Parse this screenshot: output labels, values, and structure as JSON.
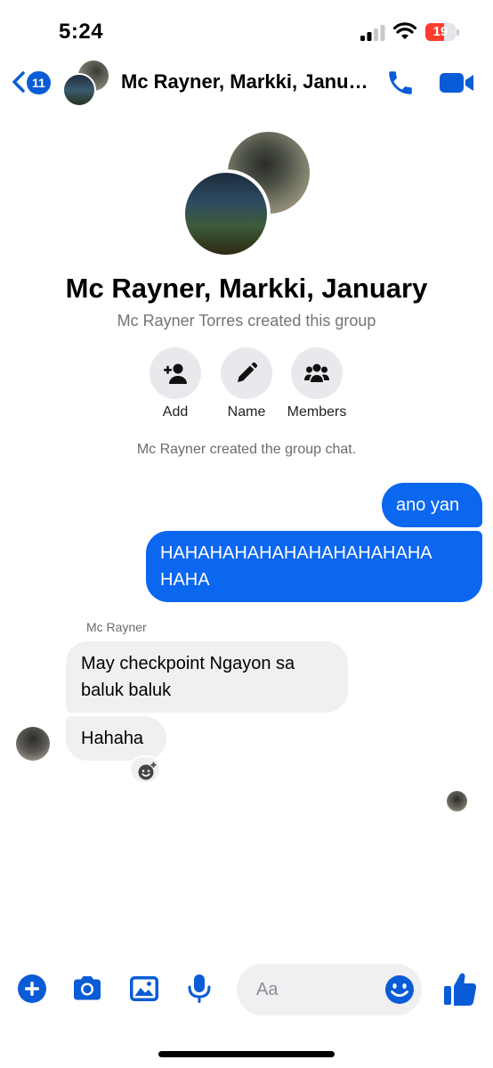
{
  "status_bar": {
    "time": "5:24",
    "battery": "19",
    "battery_level": 0.19,
    "icons": [
      "cellular-signal-icon",
      "wifi-icon",
      "battery-icon"
    ]
  },
  "header": {
    "back_count": "11",
    "title": "Mc Rayner, Markki, January",
    "icons": [
      "chevron-left-icon",
      "phone-icon",
      "video-camera-icon"
    ]
  },
  "group": {
    "name": "Mc Rayner, Markki, January",
    "creator_text": "Mc Rayner Torres created this group",
    "actions": [
      {
        "label": "Add",
        "icon": "add-person-icon"
      },
      {
        "label": "Name",
        "icon": "pencil-icon"
      },
      {
        "label": "Members",
        "icon": "members-icon"
      }
    ],
    "system_message": "Mc Rayner created the group chat."
  },
  "messages": [
    {
      "direction": "outgoing",
      "text": "ano yan"
    },
    {
      "direction": "outgoing",
      "text": "HAHAHAHAHAHAHAHAHAHAHA HAHA"
    },
    {
      "direction": "incoming",
      "sender": "Mc Rayner",
      "text": "May checkpoint Ngayon sa baluk baluk"
    },
    {
      "direction": "incoming",
      "sender": "Mc Rayner",
      "text": "Hahaha"
    }
  ],
  "composer": {
    "placeholder": "Aa",
    "value": "",
    "icons": [
      "plus-icon",
      "camera-icon",
      "photo-icon",
      "microphone-icon",
      "emoji-icon",
      "thumbs-up-icon"
    ]
  },
  "colors": {
    "accent": "#0a5cd6",
    "outgoing_bubble": "#0b66f0",
    "incoming_bubble": "#f0f0f2",
    "action_circle": "#e8e9ec",
    "battery_low": "#ff3b30"
  }
}
